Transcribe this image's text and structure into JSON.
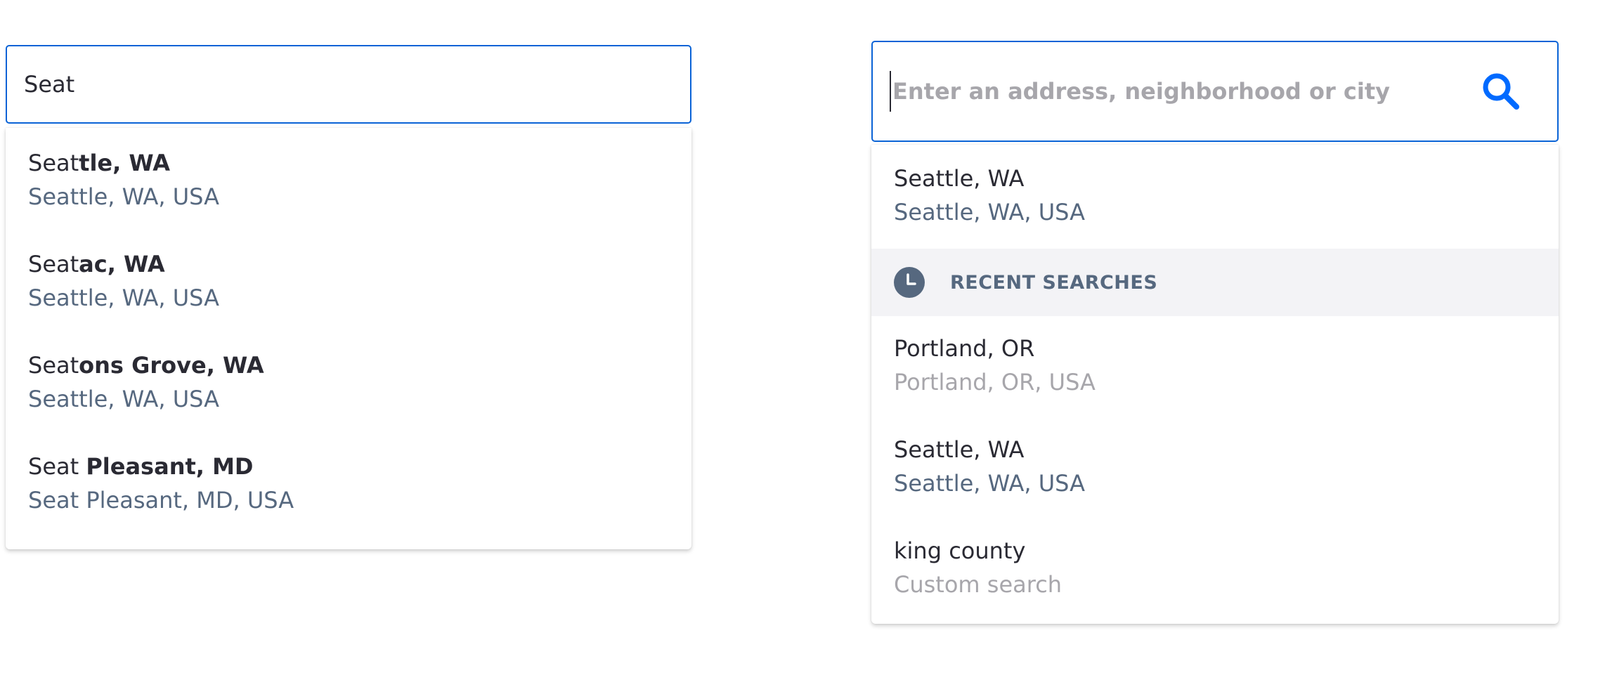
{
  "left_search": {
    "input_value": "Seat",
    "suggestions": [
      {
        "typed": "Seat",
        "rest": "tle, WA",
        "sub": "Seattle, WA, USA"
      },
      {
        "typed": "Seat",
        "rest": "ac, WA",
        "sub": "Seattle, WA, USA"
      },
      {
        "typed": "Seat",
        "rest": "ons Grove, WA",
        "sub": "Seattle, WA, USA"
      },
      {
        "typed": "Seat ",
        "rest": "Pleasant, MD",
        "sub": "Seat Pleasant, MD, USA"
      }
    ]
  },
  "right_search": {
    "placeholder": "Enter an address, neighborhood or city",
    "search_icon": "search-icon",
    "current_suggestion": {
      "title": "Seattle, WA",
      "sub": "Seattle, WA, USA"
    },
    "recent_header": {
      "icon": "clock-icon",
      "label": "RECENT SEARCHES"
    },
    "recent": [
      {
        "title": "Portland, OR",
        "sub": "Portland, OR, USA"
      },
      {
        "title": "Seattle, WA",
        "sub": "Seattle, WA, USA"
      },
      {
        "title": "king county",
        "sub": "Custom search"
      }
    ]
  },
  "colors": {
    "accent": "#0a63d6",
    "search_icon": "#006aff",
    "secondary_text": "#56687f",
    "muted_text": "#a7a6ab",
    "header_bg": "#f3f3f6"
  }
}
